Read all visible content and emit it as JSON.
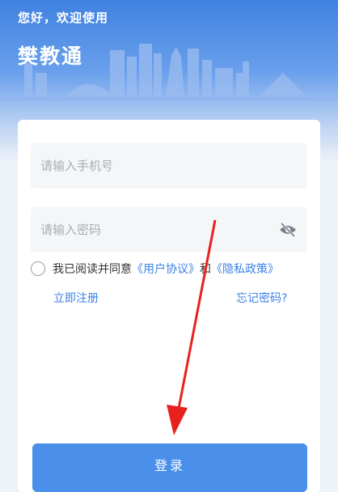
{
  "header": {
    "greeting": "您好，欢迎使用",
    "app_name": "樊教通"
  },
  "form": {
    "phone_placeholder": "请输入手机号",
    "password_placeholder": "请输入密码",
    "agreement": {
      "prefix": "我已阅读并同意",
      "user_agreement": "《用户协议》",
      "and": "和",
      "privacy_policy": "《隐私政策》"
    },
    "register_label": "立即注册",
    "forgot_label": "忘记密码?",
    "login_label": "登录"
  },
  "colors": {
    "accent": "#3b82e6",
    "button": "#4a8fea",
    "annotation_arrow": "#e8211f"
  }
}
